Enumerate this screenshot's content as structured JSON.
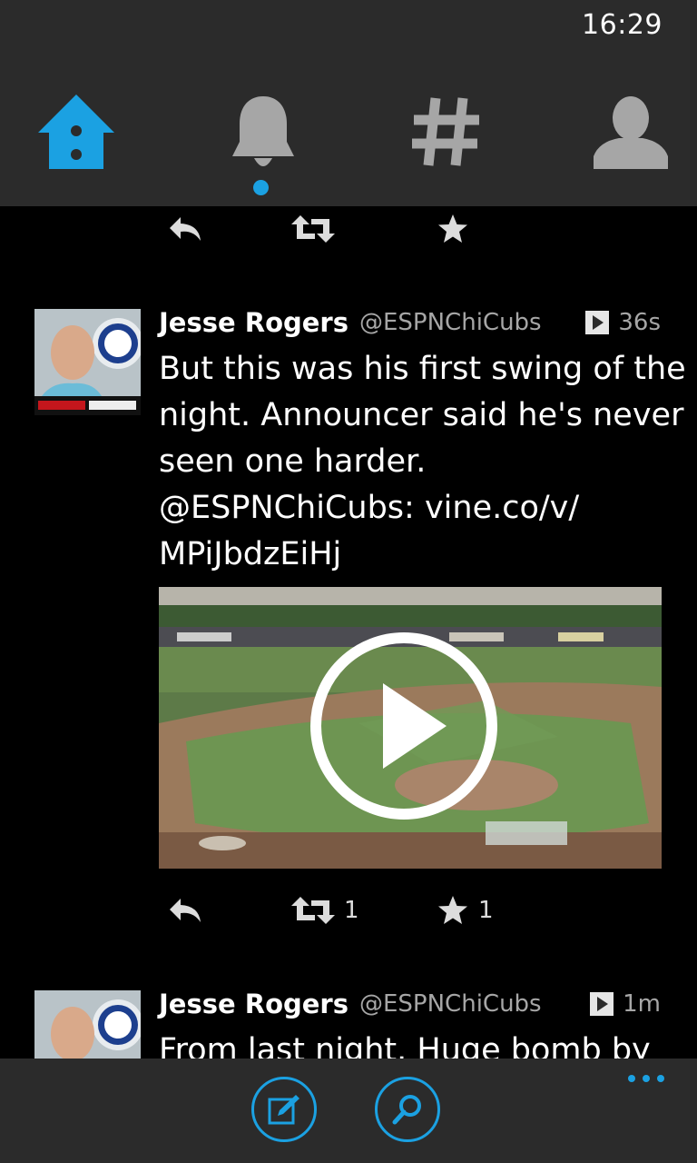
{
  "status_bar": {
    "time": "16:29"
  },
  "nav_tabs": [
    {
      "name": "home",
      "icon": "home-icon",
      "active": true
    },
    {
      "name": "notifications",
      "icon": "bell-icon",
      "has_unread": true
    },
    {
      "name": "discover",
      "icon": "hashtag-icon"
    },
    {
      "name": "profile",
      "icon": "person-icon"
    }
  ],
  "colors": {
    "accent": "#1ba1e2",
    "bar_bg": "#2b2b2b",
    "muted": "#a6a6a6"
  },
  "tweets": [
    {
      "name": "Jesse Rogers",
      "handle": "@ESPNChiCubs",
      "time": "36s",
      "has_video": true,
      "text_lines": [
        "But this was his first swing of the",
        "night. Announcer said he's never",
        "seen one harder.",
        "@ESPNChiCubs:  vine.co/v/",
        "MPiJbdzEiHj"
      ],
      "retweets": "1",
      "favorites": "1"
    },
    {
      "name": "Jesse Rogers",
      "handle": "@ESPNChiCubs",
      "time": "1m",
      "has_video": true,
      "text_lines": [
        "From last night. Huge bomb by"
      ]
    }
  ],
  "app_bar": {
    "buttons": [
      {
        "icon": "compose-icon"
      },
      {
        "icon": "search-icon"
      }
    ],
    "more_icon": "ellipsis-icon"
  }
}
